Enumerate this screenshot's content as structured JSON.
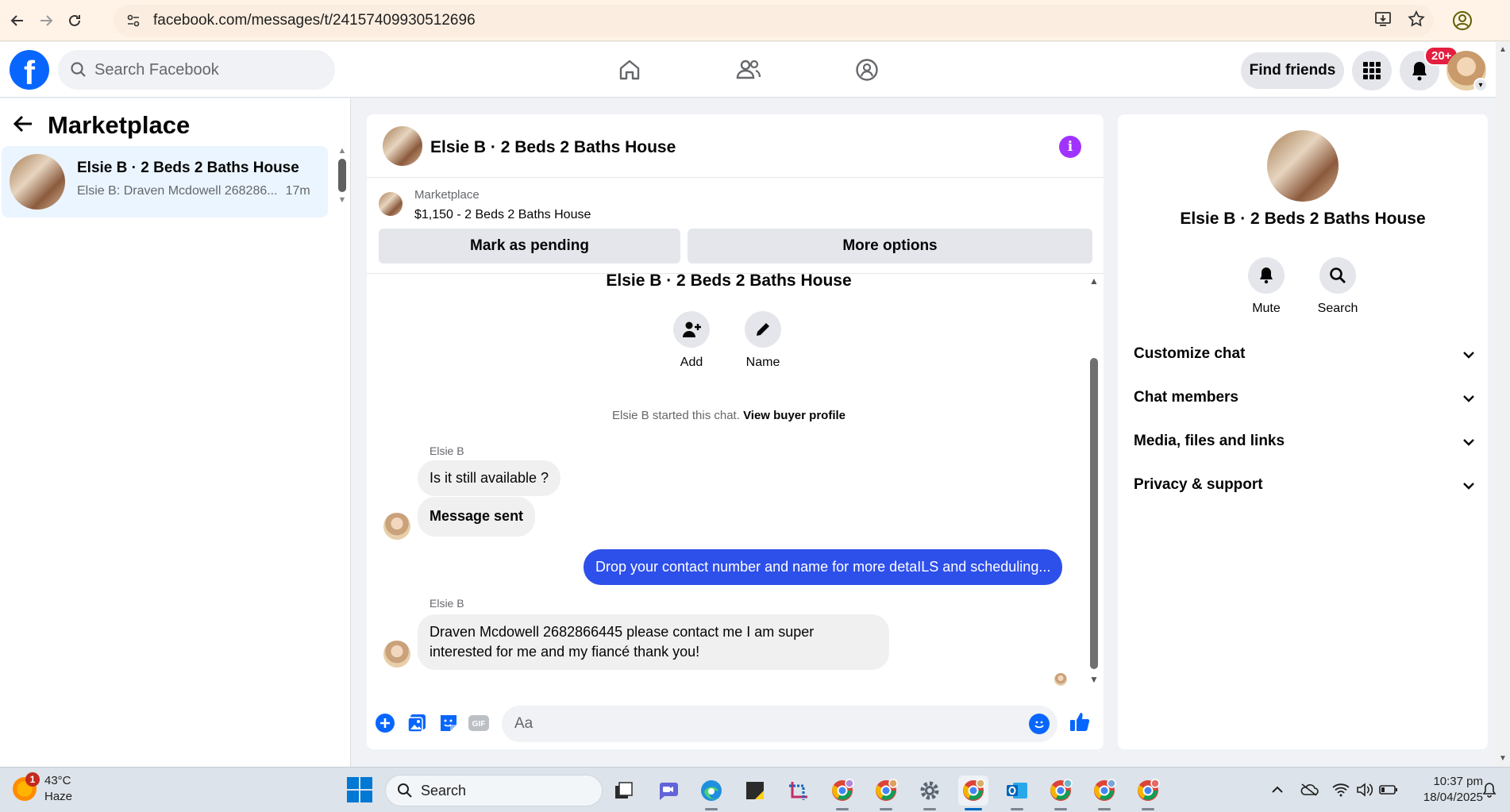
{
  "browser": {
    "url": "facebook.com/messages/t/24157409930512696"
  },
  "fb": {
    "search_placeholder": "Search Facebook",
    "find_friends": "Find friends",
    "notification_badge": "20+"
  },
  "left": {
    "title": "Marketplace",
    "conversation": {
      "name": "Elsie B · 2 Beds 2 Baths House",
      "preview": "Elsie B: Draven Mcdowell 268286...",
      "time": "17m"
    }
  },
  "chat": {
    "header_name": "Elsie B · 2 Beds 2 Baths House",
    "marketplace_label": "Marketplace",
    "listing_title": "$1,150 - 2 Beds 2 Baths House",
    "mark_pending": "Mark as pending",
    "more_options": "More options",
    "intro_title": "Elsie B · 2 Beds 2 Baths House",
    "add_label": "Add",
    "name_label": "Name",
    "started_text": "Elsie B started this chat.",
    "view_buyer_profile": "View buyer profile",
    "messages": [
      {
        "sender": "Elsie B",
        "text": "Is it still available ?"
      },
      {
        "text": "Message sent"
      },
      {
        "text": "Drop your contact number and name for more detaILS and scheduling..."
      },
      {
        "sender": "Elsie B",
        "text": "Draven Mcdowell 2682866445 please contact me I am super interested for me and my fiancé thank you!"
      }
    ],
    "composer_placeholder": "Aa"
  },
  "right": {
    "name": "Elsie B · 2 Beds 2 Baths House",
    "mute": "Mute",
    "search": "Search",
    "sections": [
      "Customize chat",
      "Chat members",
      "Media, files and links",
      "Privacy & support"
    ]
  },
  "taskbar": {
    "weather_temp": "43°C",
    "weather_cond": "Haze",
    "weather_badge": "1",
    "search": "Search",
    "time": "10:37 pm",
    "date": "18/04/2025"
  }
}
